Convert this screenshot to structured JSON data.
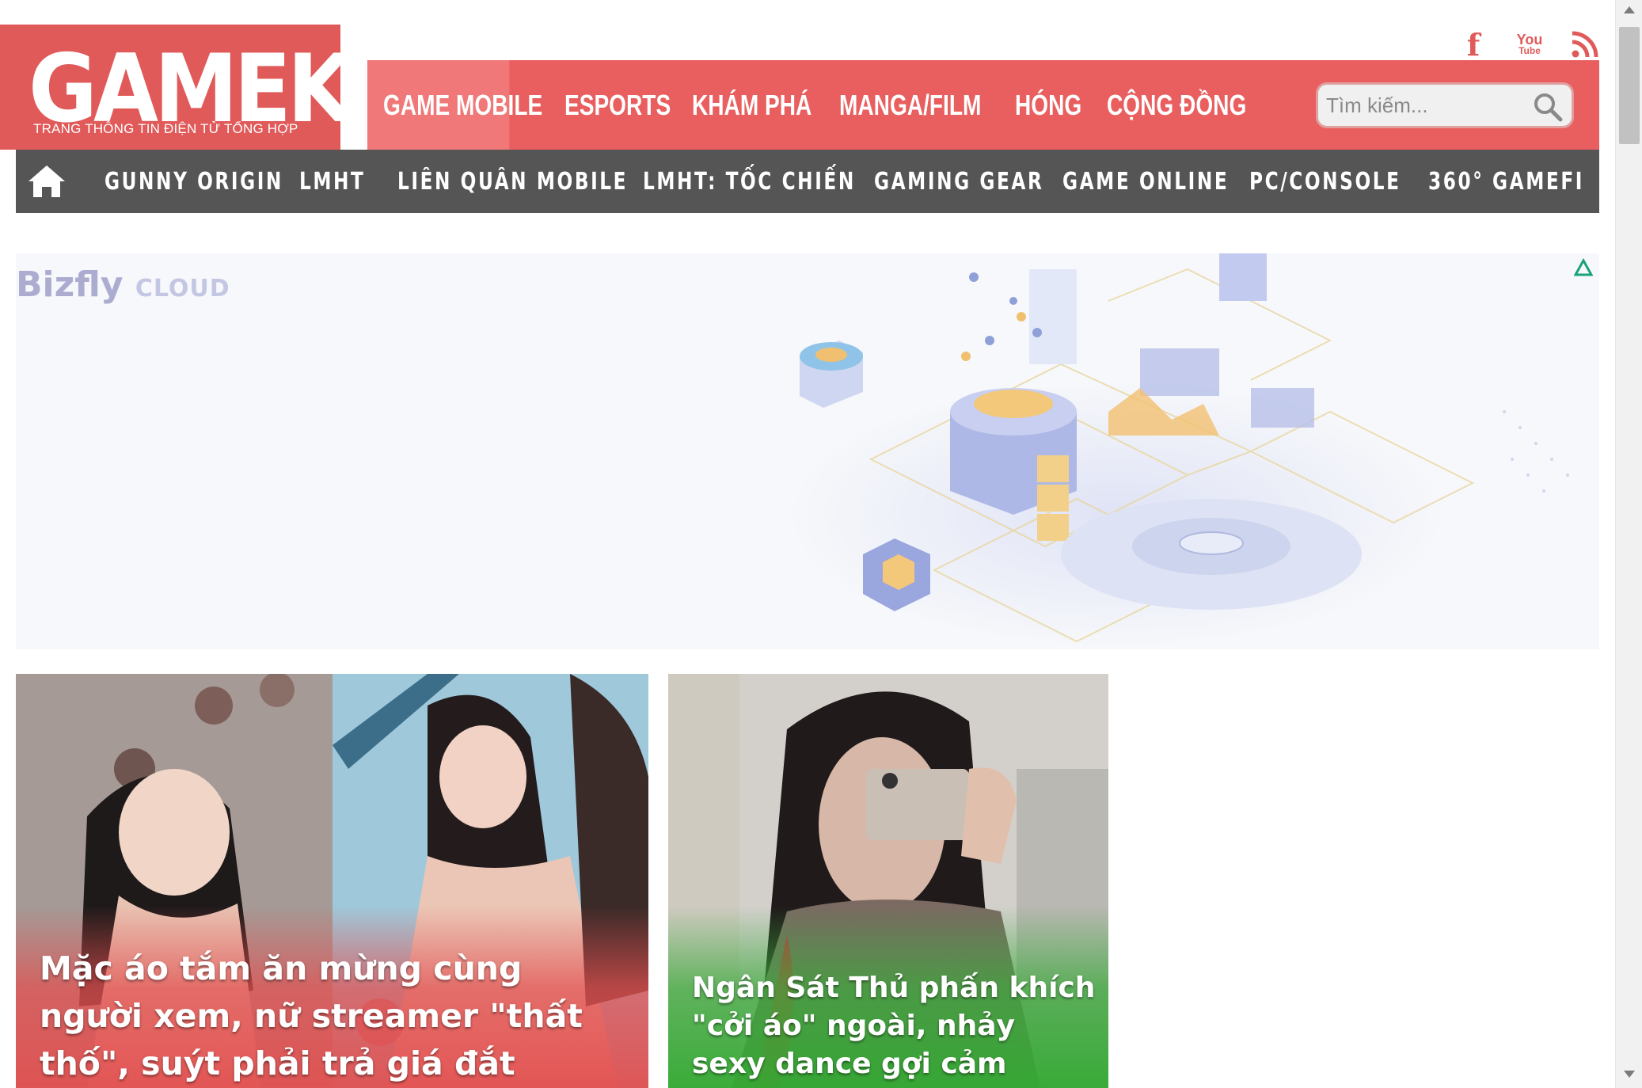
{
  "header": {
    "logo_text": "GAMEK",
    "logo_tagline": "TRANG THÔNG TIN ĐIỆN TỬ TỔNG HỢP",
    "social": {
      "facebook": "f",
      "youtube_top": "You",
      "youtube_bottom": "Tube"
    },
    "search": {
      "placeholder": "Tìm kiếm..."
    }
  },
  "top_nav": [
    {
      "label": "GAME MOBILE",
      "active": true
    },
    {
      "label": "ESPORTS"
    },
    {
      "label": "KHÁM PHÁ"
    },
    {
      "label": "MANGA/FILM"
    },
    {
      "label": "HÓNG"
    },
    {
      "label": "CỘNG ĐỒNG"
    }
  ],
  "sub_nav": [
    {
      "label": "GUNNY ORIGIN"
    },
    {
      "label": "LMHT"
    },
    {
      "label": "LIÊN QUÂN MOBILE"
    },
    {
      "label": "LMHT: TỐC CHIẾN"
    },
    {
      "label": "GAMING GEAR"
    },
    {
      "label": "GAME ONLINE"
    },
    {
      "label": "PC/CONSOLE"
    },
    {
      "label": "360° GAMEFI"
    }
  ],
  "ad": {
    "brand": "Bizfly",
    "brand_suffix": "CLOUD"
  },
  "articles": [
    {
      "title": "Mặc áo tắm ăn mừng cùng người xem, nữ streamer \"thất thố\", suýt phải trả giá đắt"
    },
    {
      "title": "Ngân Sát Thủ phấn khích \"cởi áo\" ngoài, nhảy sexy dance gợi cảm"
    }
  ],
  "colors": {
    "brand_red": "#e15a5a",
    "nav_red": "#e95f5f",
    "nav_active": "#f07878",
    "subnav_gray": "#555555",
    "card_green": "#32aa32"
  }
}
